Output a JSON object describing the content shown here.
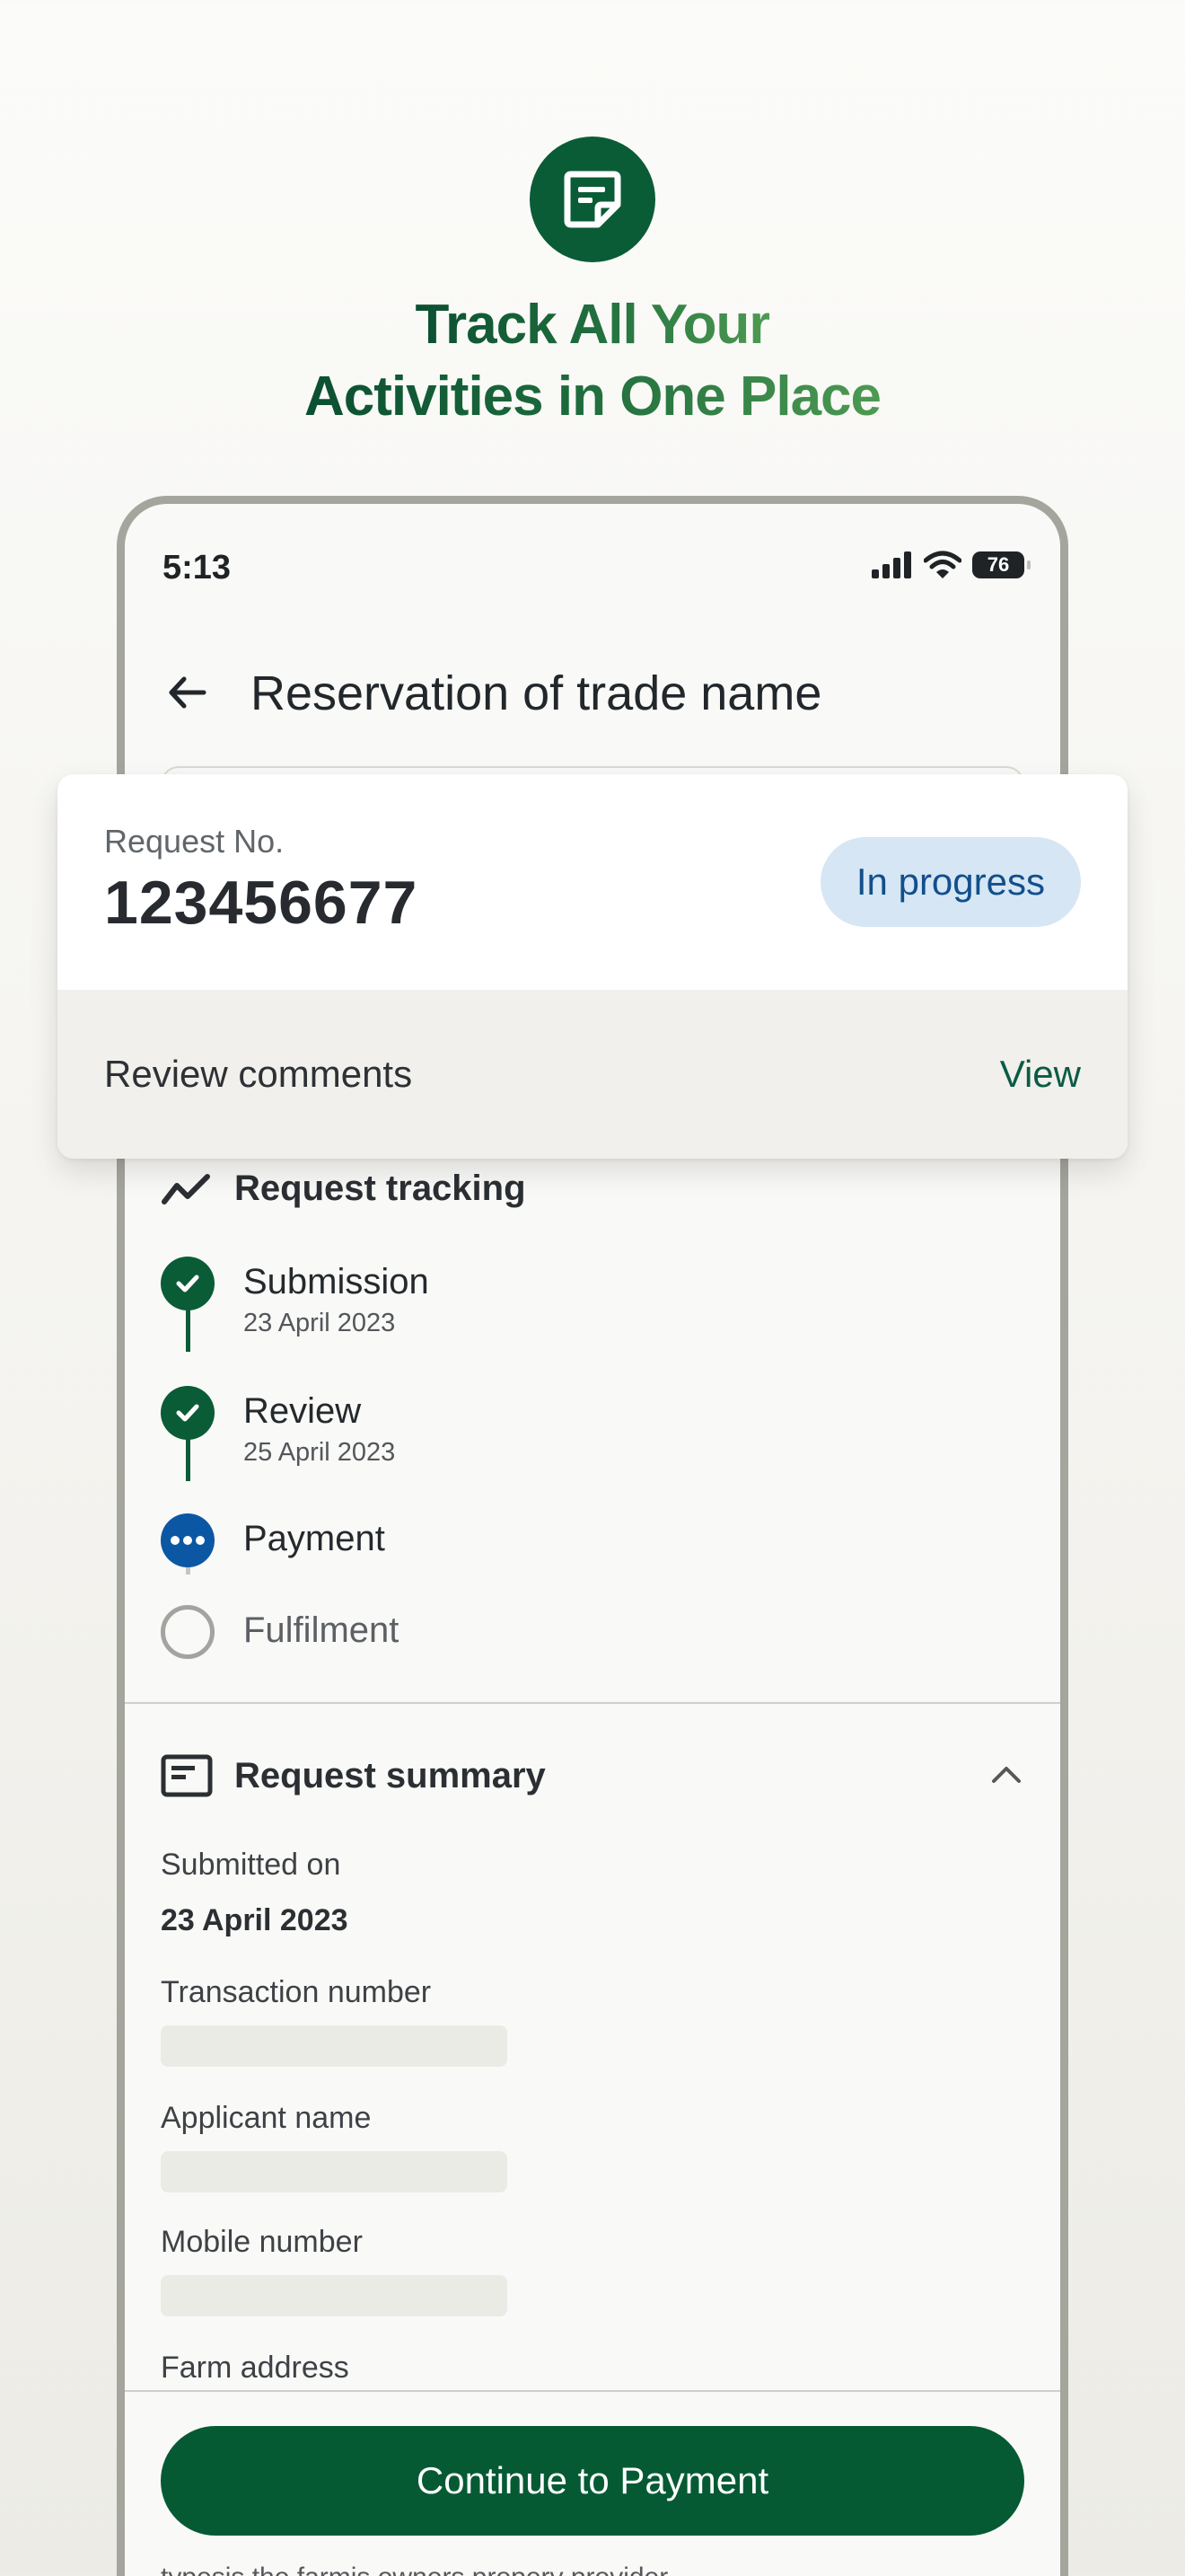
{
  "hero": {
    "title_line1": "Track All Your",
    "title_line2": "Activities in One Place",
    "icon": "document-note-icon"
  },
  "status_bar": {
    "time": "5:13",
    "battery": "76",
    "icons": [
      "signal-icon",
      "wifi-icon",
      "battery-icon"
    ]
  },
  "header": {
    "title": "Reservation of trade name",
    "back_icon": "back-arrow-icon"
  },
  "request_card": {
    "label": "Request No.",
    "number": "123456677",
    "status": "In progress",
    "review_label": "Review comments",
    "view_label": "View"
  },
  "tracking": {
    "title": "Request tracking",
    "steps": [
      {
        "label": "Submission",
        "date": "23 April 2023",
        "state": "done"
      },
      {
        "label": "Review",
        "date": "25 April 2023",
        "state": "done"
      },
      {
        "label": "Payment",
        "date": "",
        "state": "current"
      },
      {
        "label": "Fulfilment",
        "date": "",
        "state": "pending"
      }
    ]
  },
  "summary": {
    "title": "Request summary",
    "submitted_label": "Submitted on",
    "submitted_value": "23 April 2023",
    "transaction_label": "Transaction number",
    "applicant_label": "Applicant name",
    "mobile_label": "Mobile number",
    "farm_label": "Farm address"
  },
  "footer": {
    "cta_label": "Continue to Payment",
    "cut_text": "typesis the farmis owners propery provider"
  },
  "colors": {
    "brand_green": "#0a5c36",
    "progress_blue": "#0b57a4",
    "pill_bg": "#d6e6f4"
  }
}
